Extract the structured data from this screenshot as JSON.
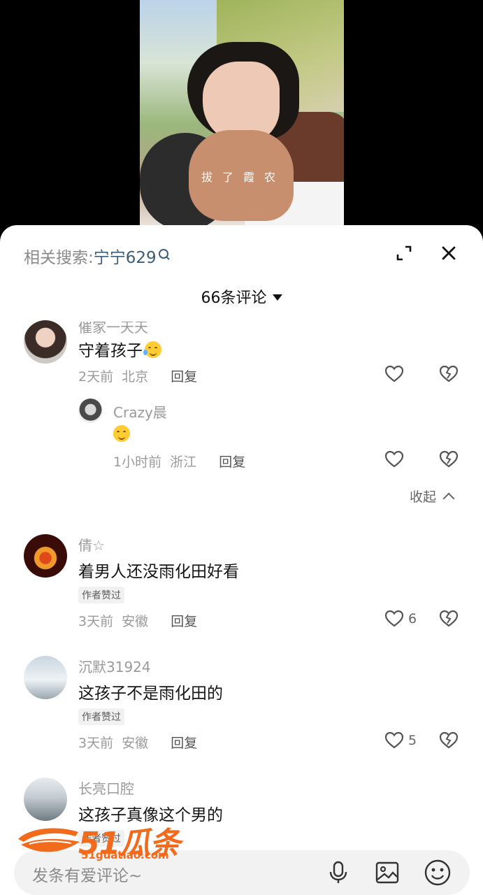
{
  "video": {
    "caption": "拔了霞农"
  },
  "header": {
    "related_label": "相关搜索:",
    "related_keyword": "宁宁629",
    "comment_count": "66条评论"
  },
  "comments": [
    {
      "username": "催家一天天",
      "text": "守着孩子",
      "emoji": "crying-laughing-emoji",
      "time": "2天前",
      "location": "北京",
      "reply_label": "回复",
      "replies": [
        {
          "username": "Crazy晨",
          "emoji": "smiling-emoji",
          "time": "1小时前",
          "location": "浙江",
          "reply_label": "回复"
        }
      ],
      "collapse_label": "收起"
    },
    {
      "username": "倩☆",
      "text": "着男人还没雨化田好看",
      "tag": "作者赞过",
      "time": "3天前",
      "location": "安徽",
      "reply_label": "回复",
      "likes": "6"
    },
    {
      "username": "沉默31924",
      "text": "这孩子不是雨化田的",
      "tag": "作者赞过",
      "time": "3天前",
      "location": "安徽",
      "reply_label": "回复",
      "likes": "5"
    },
    {
      "username": "长亮口腔",
      "text": "这孩子真像这个男的",
      "tag": "作者赞过"
    }
  ],
  "input": {
    "placeholder": "发条有爱评论~"
  },
  "watermark": {
    "brand": "51瓜条",
    "url": "51guatiao.com"
  },
  "colors": {
    "keyword": "#3d5c7a",
    "watermark": "#f26a1b"
  }
}
